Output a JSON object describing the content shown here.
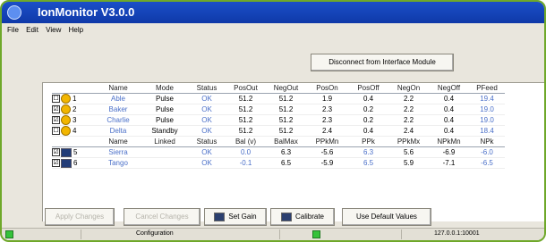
{
  "window": {
    "title": "IonMonitor V3.0.0"
  },
  "menu": [
    "File",
    "Edit",
    "View",
    "Help"
  ],
  "disconnect_label": "Disconnect from Interface Module",
  "table1": {
    "headers": [
      "",
      "Name",
      "Mode",
      "Status",
      "PosOut",
      "NegOut",
      "PosOn",
      "PosOff",
      "NegOn",
      "NegOff",
      "PFeed"
    ],
    "rows": [
      {
        "num": "1",
        "name": "Able",
        "mode": "Pulse",
        "status": "OK",
        "pos_out": "51.2",
        "neg_out": "51.2",
        "pos_on": "1.9",
        "pos_off": "0.4",
        "neg_on": "2.2",
        "neg_off": "0.4",
        "pfeed": "19.4",
        "checked": "☐"
      },
      {
        "num": "2",
        "name": "Baker",
        "mode": "Pulse",
        "status": "OK",
        "pos_out": "51.2",
        "neg_out": "51.2",
        "pos_on": "2.3",
        "pos_off": "0.2",
        "neg_on": "2.2",
        "neg_off": "0.4",
        "pfeed": "19.0",
        "checked": "☑"
      },
      {
        "num": "3",
        "name": "Charlie",
        "mode": "Pulse",
        "status": "OK",
        "pos_out": "51.2",
        "neg_out": "51.2",
        "pos_on": "2.3",
        "pos_off": "0.2",
        "neg_on": "2.2",
        "neg_off": "0.4",
        "pfeed": "19.0",
        "checked": "☑"
      },
      {
        "num": "4",
        "name": "Delta",
        "mode": "Standby",
        "status": "OK",
        "pos_out": "51.2",
        "neg_out": "51.2",
        "pos_on": "2.4",
        "pos_off": "0.4",
        "neg_on": "2.4",
        "neg_off": "0.4",
        "pfeed": "18.4",
        "checked": "☐"
      }
    ]
  },
  "table2": {
    "headers": [
      "",
      "Name",
      "Linked",
      "Status",
      "Bal (v)",
      "BalMax",
      "PPkMn",
      "PPk",
      "PPkMx",
      "NPkMn",
      "NPk"
    ],
    "rows": [
      {
        "num": "5",
        "name": "Sierra",
        "linked": "",
        "status": "OK",
        "bal": "0.0",
        "balmax": "6.3",
        "ppkmn": "-5.6",
        "ppk": "6.3",
        "ppkmx": "5.6",
        "npkmn": "-6.9",
        "npk": "-6.0",
        "checked": "☑"
      },
      {
        "num": "6",
        "name": "Tango",
        "linked": "",
        "status": "OK",
        "bal": "-0.1",
        "balmax": "6.5",
        "ppkmn": "-5.9",
        "ppk": "6.5",
        "ppkmx": "5.9",
        "npkmn": "-7.1",
        "npk": "-6.5",
        "checked": "☑"
      }
    ]
  },
  "buttons": {
    "apply": "Apply Changes",
    "cancel": "Cancel Changes",
    "set_gain": "Set Gain",
    "calibrate": "Calibrate",
    "defaults": "Use Default Values"
  },
  "statusbar": {
    "section": "Configuration",
    "address": "127.0.0.1:10001"
  },
  "colors": {
    "title_bar": "#1b4fc9",
    "frame": "#6fa82a",
    "led": "#35c23a",
    "value_blue": "#4a6fc8"
  }
}
